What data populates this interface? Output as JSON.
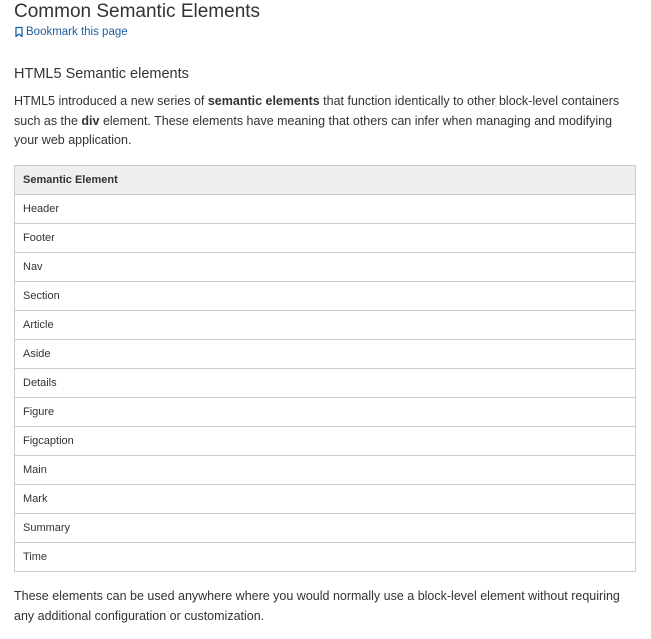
{
  "page": {
    "title": "Common Semantic Elements",
    "bookmark_label": "Bookmark this page"
  },
  "section": {
    "heading": "HTML5 Semantic elements",
    "intro": {
      "part1": "HTML5 introduced a new series of ",
      "bold1": "semantic elements",
      "part2": " that function identically to other block-level containers such as the ",
      "bold2": "div",
      "part3": " element. These elements have meaning that others can infer when managing and modifying your web application."
    },
    "table": {
      "header": "Semantic Element",
      "rows": [
        "Header",
        "Footer",
        "Nav",
        "Section",
        "Article",
        "Aside",
        "Details",
        "Figure",
        "Figcaption",
        "Main",
        "Mark",
        "Summary",
        "Time"
      ]
    },
    "outro": "These elements can be used anywhere where you would normally use a block-level element without requiring any additional configuration or customization."
  },
  "colors": {
    "link": "#1a5f9e",
    "text": "#333333",
    "table_header_bg": "#efefef",
    "table_border": "#cccccc"
  },
  "icons": {
    "bookmark": "bookmark-icon"
  }
}
